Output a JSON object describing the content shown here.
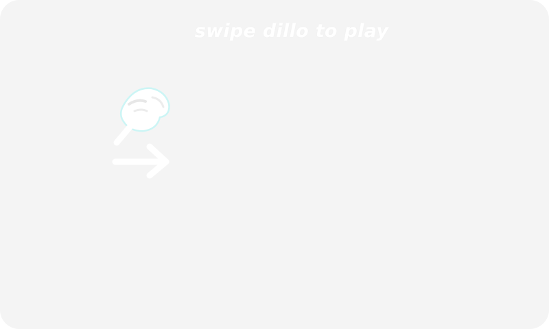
{
  "game": {
    "prompt": "swipe dillo to play"
  },
  "hint": {
    "hand_icon": "pointing-hand-icon",
    "arrow_icon": "right-arrow-icon",
    "direction": "right"
  },
  "colors": {
    "background": "#f4f4f4",
    "text": "#ffffff",
    "hand_glow": "#c8f6f6"
  }
}
